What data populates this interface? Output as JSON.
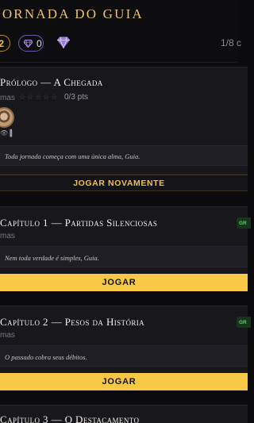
{
  "header": {
    "title": "Jornada do Guia",
    "gold_count": "2",
    "gem_count": "0",
    "progress": "1/8 c"
  },
  "chapters": [
    {
      "title": "Prólogo — A Chegada",
      "meta": "mas",
      "stars_total": 5,
      "stars_filled": 0,
      "points": "0/3 pts",
      "avatar_badge": "👁 ▌",
      "quote": "Toda jornada começa com uma única alma, Guia.",
      "action": "JOGAR NOVAMENTE"
    },
    {
      "title": "Capítulo 1 — Partidas Silenciosas",
      "meta": "mas",
      "badge": "GR",
      "quote": "Nem toda verdade é simples, Guia.",
      "action": "JOGAR"
    },
    {
      "title": "Capítulo 2 — Pesos da História",
      "meta": "mas",
      "badge": "GR",
      "quote": "O passado cobra seus débitos.",
      "action": "JOGAR"
    },
    {
      "title": "Capítulo 3 — O Destacamento"
    }
  ],
  "colors": {
    "accent_gold": "#f6c845",
    "background": "#0b0b0e",
    "card": "#17171c",
    "gem": "#9b7de0"
  }
}
